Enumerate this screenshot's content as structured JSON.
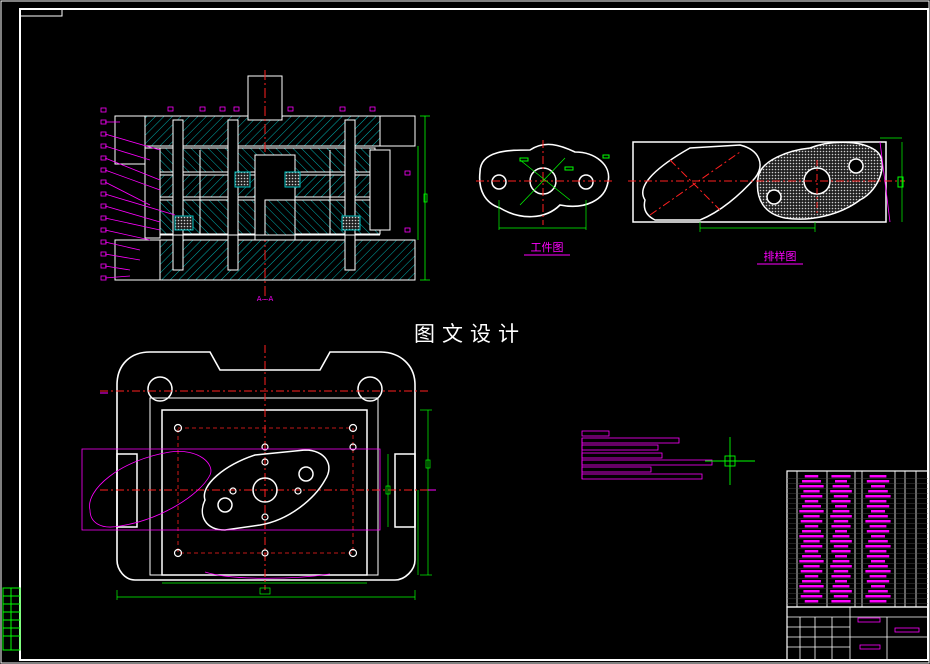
{
  "drawing": {
    "center_title": "图文设计",
    "workpiece_caption": "工件图",
    "layout_caption": "排样图",
    "section_label": "A—A"
  },
  "colors": {
    "background": "#000000",
    "frame": "#ffffff",
    "centerline": "#ff2020",
    "dimension": "#00ff00",
    "leader": "#ff00ff",
    "hatch": "#00c0c0",
    "outline": "#ffffff",
    "table": "#ff00ff"
  }
}
